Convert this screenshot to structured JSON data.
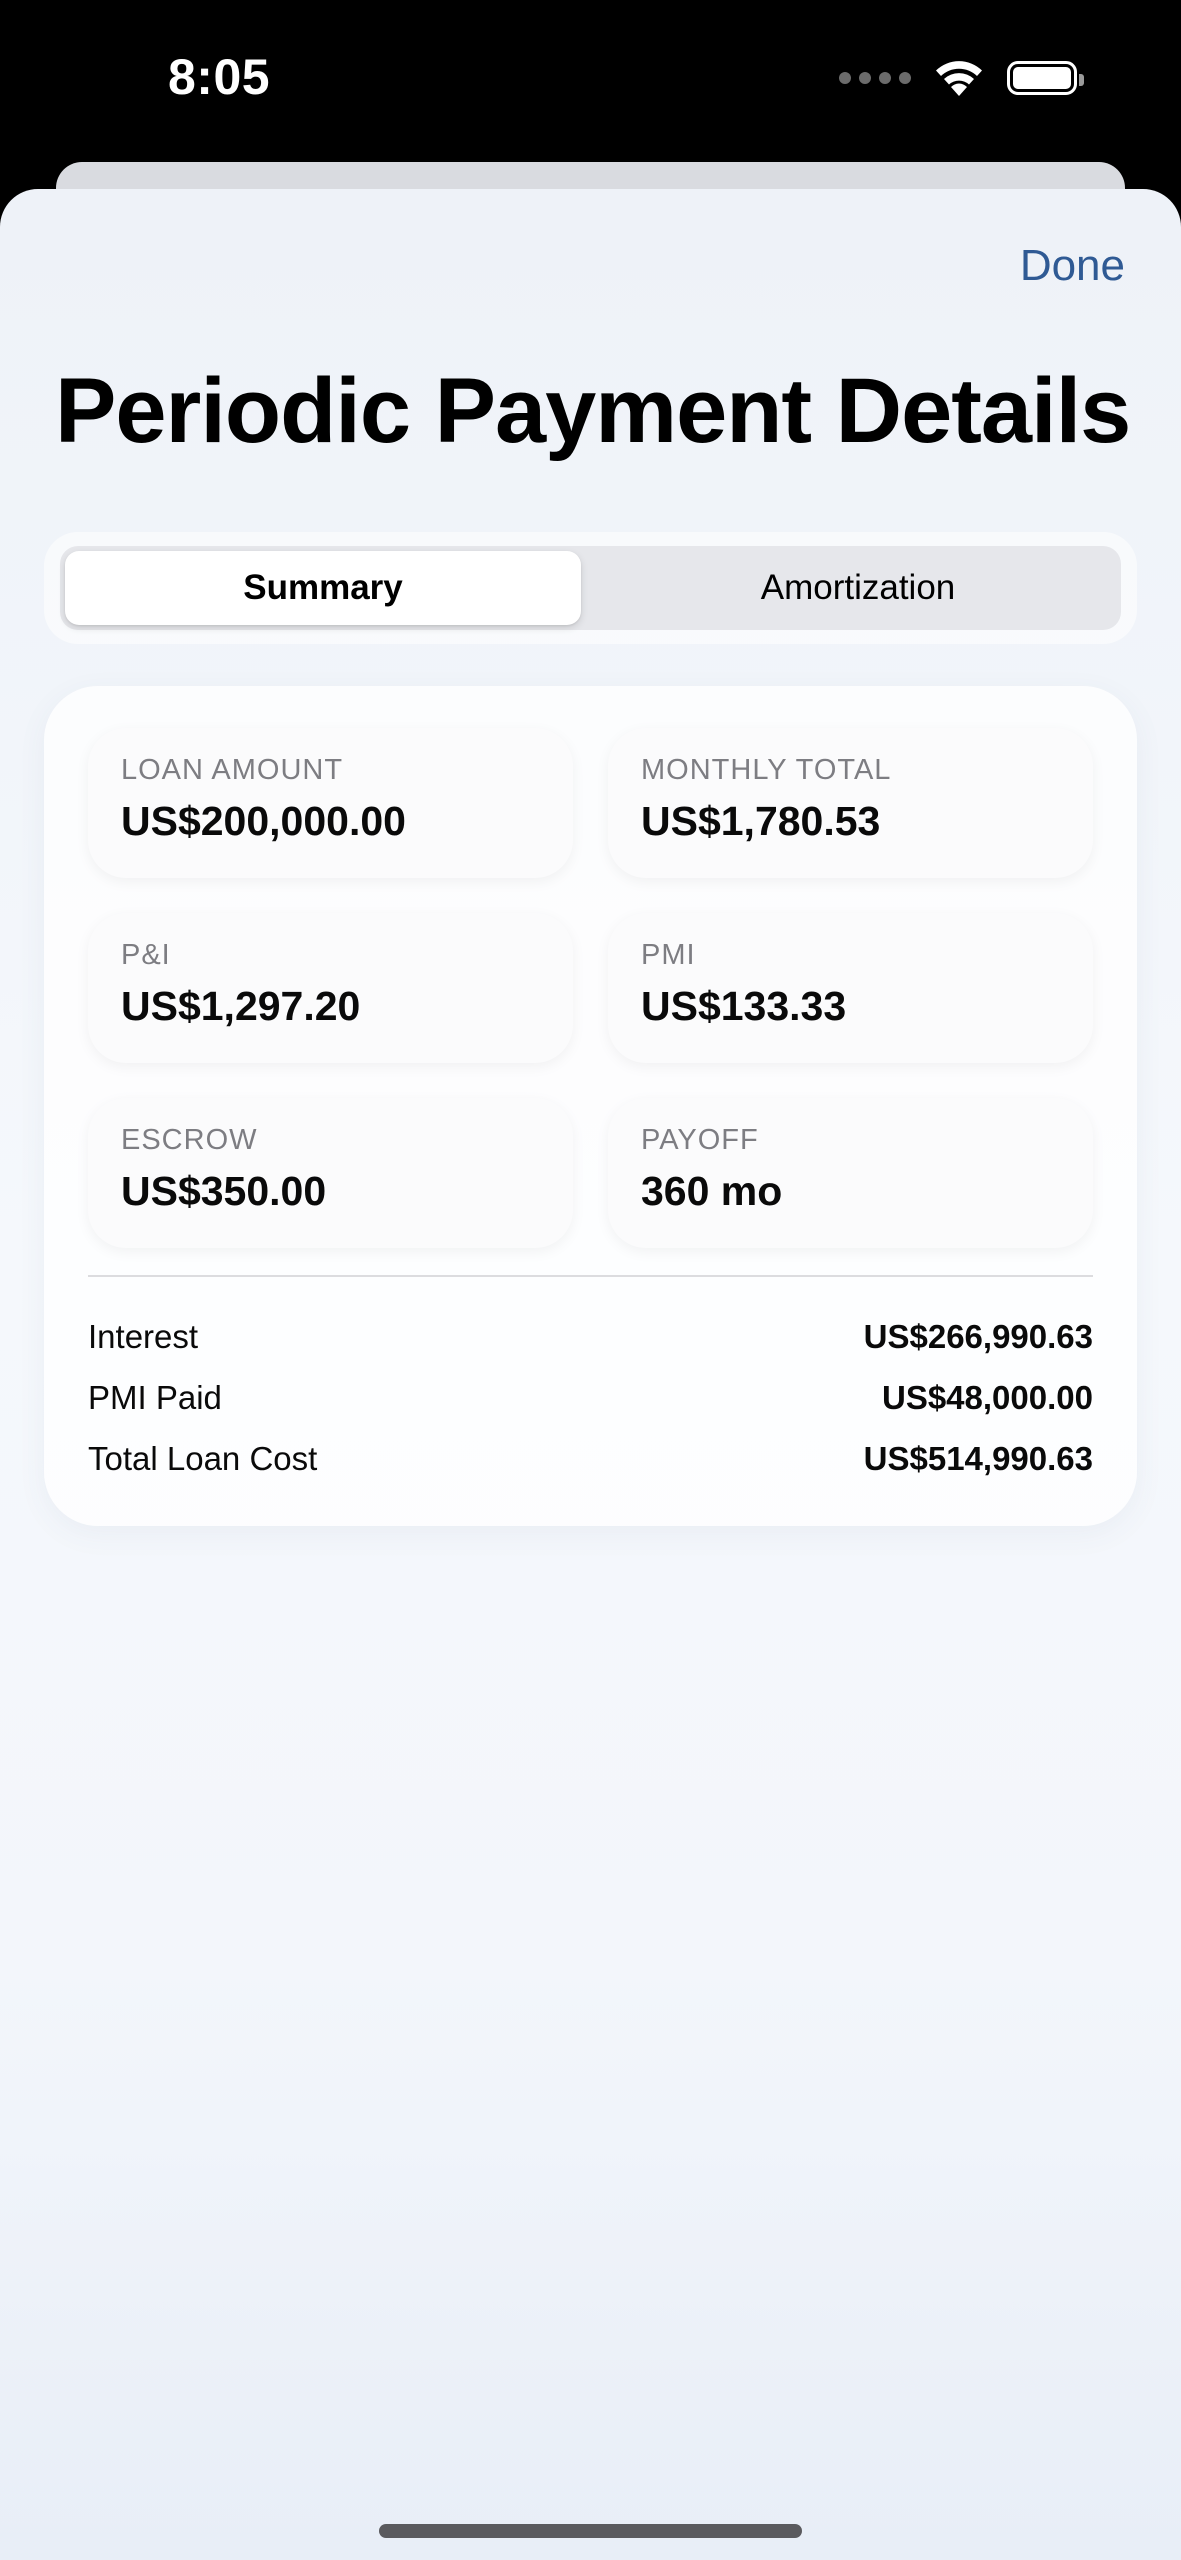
{
  "status_bar": {
    "time": "8:05"
  },
  "header": {
    "done_label": "Done",
    "title": "Periodic Payment Details"
  },
  "tabs": [
    {
      "label": "Summary",
      "selected": true
    },
    {
      "label": "Amortization",
      "selected": false
    }
  ],
  "summary": {
    "tiles": [
      {
        "label": "LOAN AMOUNT",
        "value": "US$200,000.00"
      },
      {
        "label": "MONTHLY TOTAL",
        "value": "US$1,780.53"
      },
      {
        "label": "P&I",
        "value": "US$1,297.20"
      },
      {
        "label": "PMI",
        "value": "US$133.33"
      },
      {
        "label": "ESCROW",
        "value": "US$350.00"
      },
      {
        "label": "PAYOFF",
        "value": "360 mo"
      }
    ],
    "totals": [
      {
        "label": "Interest",
        "value": "US$266,990.63"
      },
      {
        "label": "PMI Paid",
        "value": "US$48,000.00"
      },
      {
        "label": "Total Loan Cost",
        "value": "US$514,990.63"
      }
    ]
  },
  "colors": {
    "accent": "#2f5a94",
    "status_bar_background": "#000000",
    "sheet_background": "#f3f6fb"
  },
  "icons": [
    "cellular-signal-icon",
    "wifi-icon",
    "battery-icon"
  ]
}
